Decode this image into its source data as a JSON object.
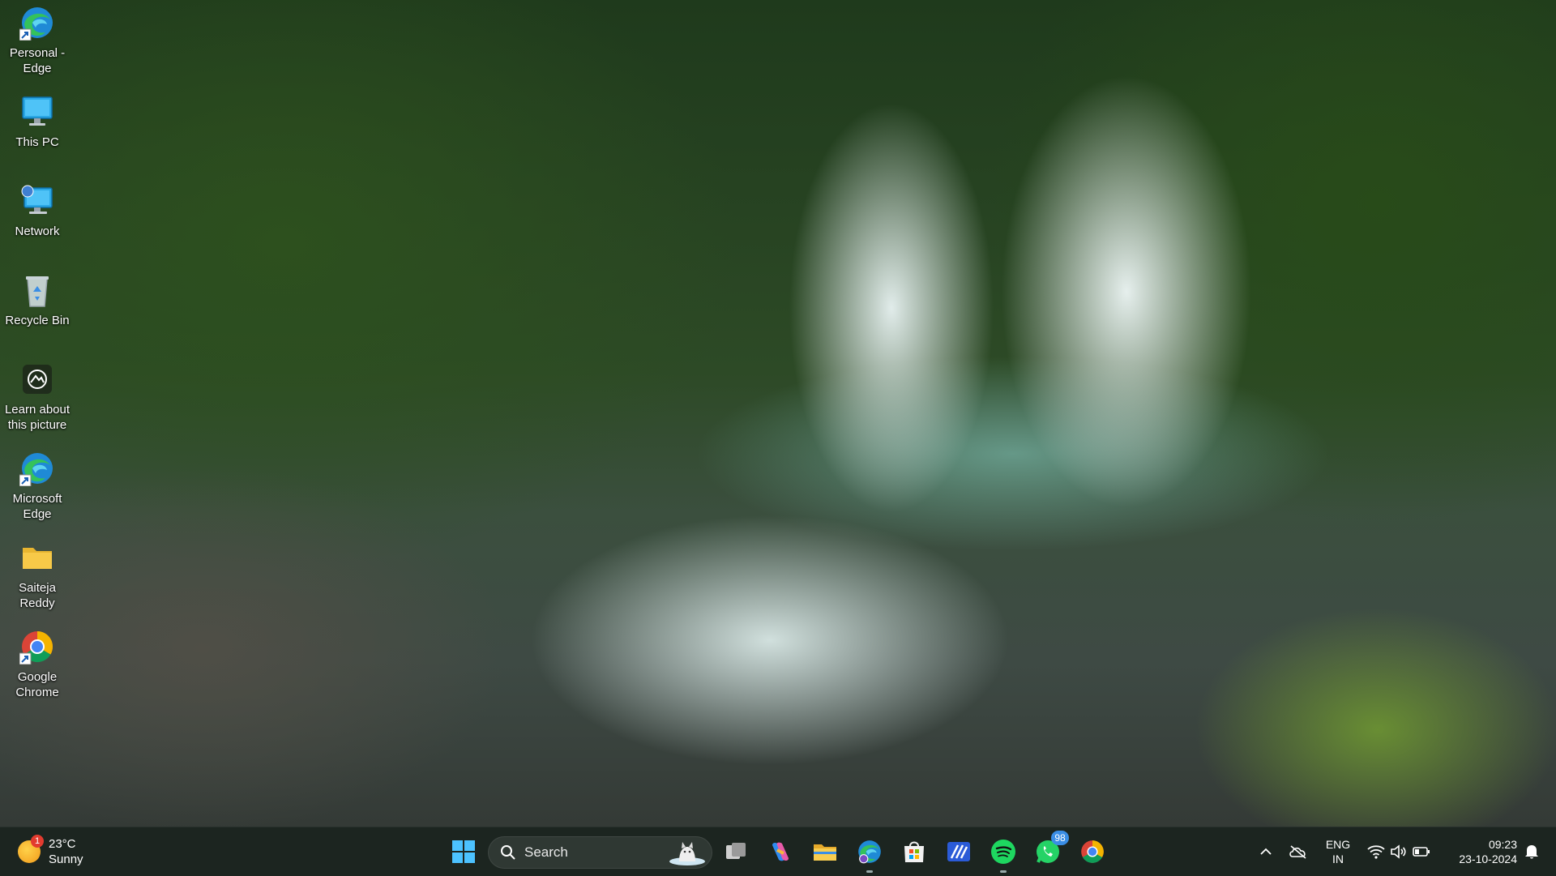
{
  "desktop": {
    "icons": [
      {
        "label": "Personal - Edge",
        "icon": "edge-icon"
      },
      {
        "label": "This PC",
        "icon": "monitor-icon"
      },
      {
        "label": "Network",
        "icon": "network-icon"
      },
      {
        "label": "Recycle Bin",
        "icon": "recycle-bin-icon"
      },
      {
        "label": "Learn about this picture",
        "icon": "camera-icon"
      },
      {
        "label": "Microsoft Edge",
        "icon": "edge-icon"
      },
      {
        "label": "Saiteja Reddy",
        "icon": "folder-icon"
      },
      {
        "label": "Google Chrome",
        "icon": "chrome-icon"
      }
    ]
  },
  "taskbar": {
    "weather": {
      "temp": "23°C",
      "condition": "Sunny",
      "badge": "1"
    },
    "search": {
      "label": "Search"
    },
    "apps": [
      {
        "name": "start-button",
        "icon": "windows-logo-icon"
      },
      {
        "name": "task-view",
        "icon": "task-view-icon"
      },
      {
        "name": "copilot",
        "icon": "copilot-icon"
      },
      {
        "name": "file-explorer",
        "icon": "folder-icon"
      },
      {
        "name": "edge-profile",
        "icon": "edge-icon"
      },
      {
        "name": "microsoft-store",
        "icon": "store-icon"
      },
      {
        "name": "app-generic",
        "icon": "slash-app-icon"
      },
      {
        "name": "spotify",
        "icon": "spotify-icon"
      },
      {
        "name": "whatsapp",
        "icon": "whatsapp-icon",
        "badge": "98"
      },
      {
        "name": "chrome",
        "icon": "chrome-icon"
      }
    ],
    "tray": {
      "lang_line1": "ENG",
      "lang_line2": "IN",
      "time": "09:23",
      "date": "23-10-2024"
    }
  },
  "colors": {
    "taskbar_bg": "#1c2520",
    "search_bg": "#2f3833",
    "accent_blue": "#3a8ee6"
  }
}
